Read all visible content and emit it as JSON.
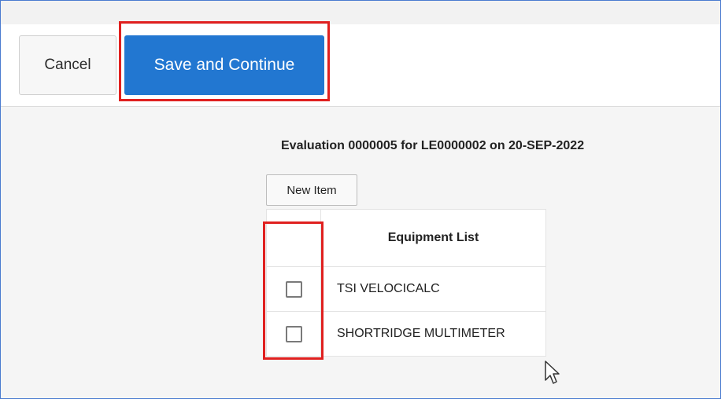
{
  "toolbar": {
    "cancel_label": "Cancel",
    "save_label": "Save and Continue"
  },
  "evaluation": {
    "heading": "Evaluation 0000005 for LE0000002 on 20-SEP-2022",
    "new_item_label": "New Item"
  },
  "equipment_table": {
    "header": "Equipment List",
    "rows": [
      {
        "name": "TSI VELOCICALC",
        "checked": false
      },
      {
        "name": "SHORTRIDGE MULTIMETER",
        "checked": false
      }
    ]
  },
  "colors": {
    "primary_button": "#2277d1",
    "highlight_annotation": "#e0201f",
    "window_border": "#4a7bd0"
  }
}
